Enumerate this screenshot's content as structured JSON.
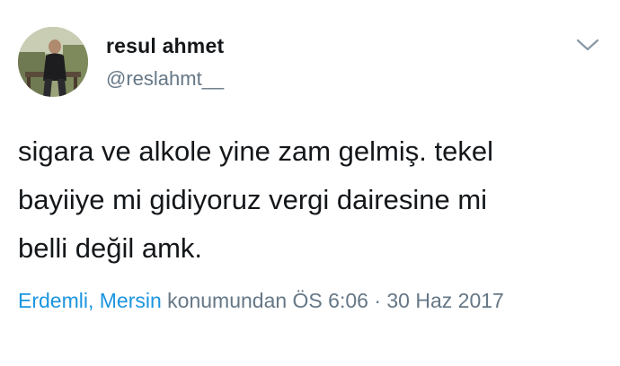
{
  "user": {
    "display_name": "resul ahmet",
    "handle": "@reslahmt__"
  },
  "tweet": {
    "text_line_1": "sigara ve alkole yine zam gelmiş. tekel",
    "text_line_2": "bayiiye mi gidiyoruz vergi dairesine mi",
    "text_line_3": "belli değil amk."
  },
  "meta": {
    "location": "Erdemli, Mersin",
    "location_suffix": "konumundan",
    "time": "ÖS 6:06",
    "separator": "·",
    "date": "30 Haz 2017"
  },
  "icons": {
    "menu": "chevron-down-icon"
  },
  "colors": {
    "text": "#14171a",
    "secondary": "#657786",
    "link": "#1b95e0"
  }
}
